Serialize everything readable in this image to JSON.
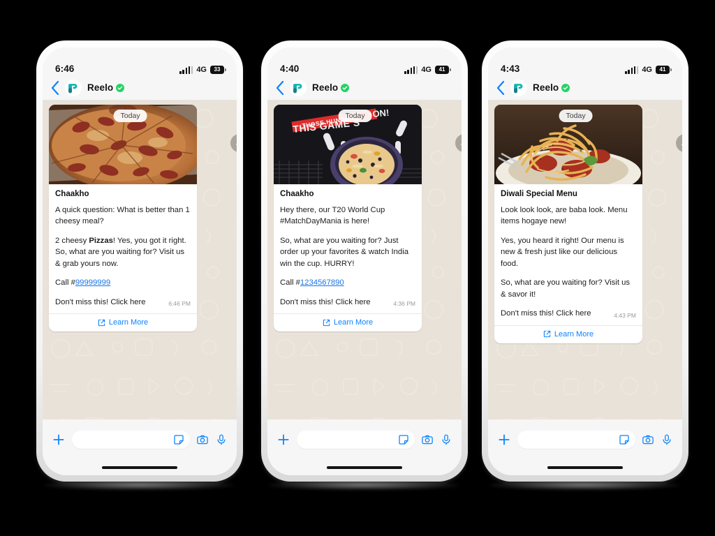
{
  "theme": {
    "accent_blue": "#0a84ff",
    "link_blue": "#1a74e8",
    "verified_green": "#25d366",
    "chat_bg": "#e9e2d8",
    "bubble_bg": "#ffffff",
    "frame": "#f3f3f3",
    "page_bg": "#000000"
  },
  "phones": [
    {
      "id": "phone-1",
      "status": {
        "time": "6:46",
        "network": "4G",
        "battery": "33"
      },
      "header": {
        "contact": "Reelo",
        "verified": true,
        "back": "back",
        "avatar": "reelo-logo"
      },
      "message": {
        "date_pill": "Today",
        "image": "pepperoni-pizza",
        "title": "Chaakho",
        "paragraphs": [
          {
            "text": "A quick question: What is better than 1 cheesy meal?"
          },
          {
            "pre": "2 cheesy ",
            "bold": "Pizzas",
            "post": "! Yes, you got it right. So, what are you waiting for? Visit us & grab yours now."
          },
          {
            "pre": "Call #",
            "link": "99999999"
          }
        ],
        "closing": "Don't miss this! Click here",
        "timestamp": "6:46 PM",
        "cta": "Learn More"
      },
      "input": {
        "placeholder": "",
        "value": ""
      }
    },
    {
      "id": "phone-2",
      "status": {
        "time": "4:40",
        "network": "4G",
        "battery": "41"
      },
      "header": {
        "contact": "Reelo",
        "verified": true,
        "back": "back",
        "avatar": "reelo-logo"
      },
      "message": {
        "date_pill": "Today",
        "image": "matchday-chalkboard-pizza",
        "image_text": {
          "ribbon": "THOSE HUNGER",
          "headline_left": "THIS GAME S",
          "headline_right": "ON!"
        },
        "title": "Chaakho",
        "paragraphs": [
          {
            "text": "Hey there, our T20 World Cup #MatchDayMania is here!"
          },
          {
            "text": "So, what are you waiting for? Just order up your favorites & watch India win the cup. HURRY!"
          },
          {
            "pre": "Call #",
            "link": "1234567890"
          }
        ],
        "closing": "Don't miss this! Click here",
        "timestamp": "4:36 PM",
        "cta": "Learn More"
      },
      "input": {
        "placeholder": "",
        "value": ""
      }
    },
    {
      "id": "phone-3",
      "status": {
        "time": "4:43",
        "network": "4G",
        "battery": "41"
      },
      "header": {
        "contact": "Reelo",
        "verified": true,
        "back": "back",
        "avatar": "reelo-logo"
      },
      "message": {
        "date_pill": "Today",
        "image": "spaghetti-pasta",
        "title": "Diwali Special Menu",
        "paragraphs": [
          {
            "text": "Look look look, are baba look. Menu items hogaye new!"
          },
          {
            "text": "Yes, you heard it right! Our menu is new & fresh just like our delicious food."
          },
          {
            "text": "So, what are you waiting for? Visit us & savor it!"
          }
        ],
        "closing": "Don't miss this! Click here",
        "timestamp": "4:43 PM",
        "cta": "Learn More"
      },
      "input": {
        "placeholder": "",
        "value": ""
      }
    }
  ]
}
